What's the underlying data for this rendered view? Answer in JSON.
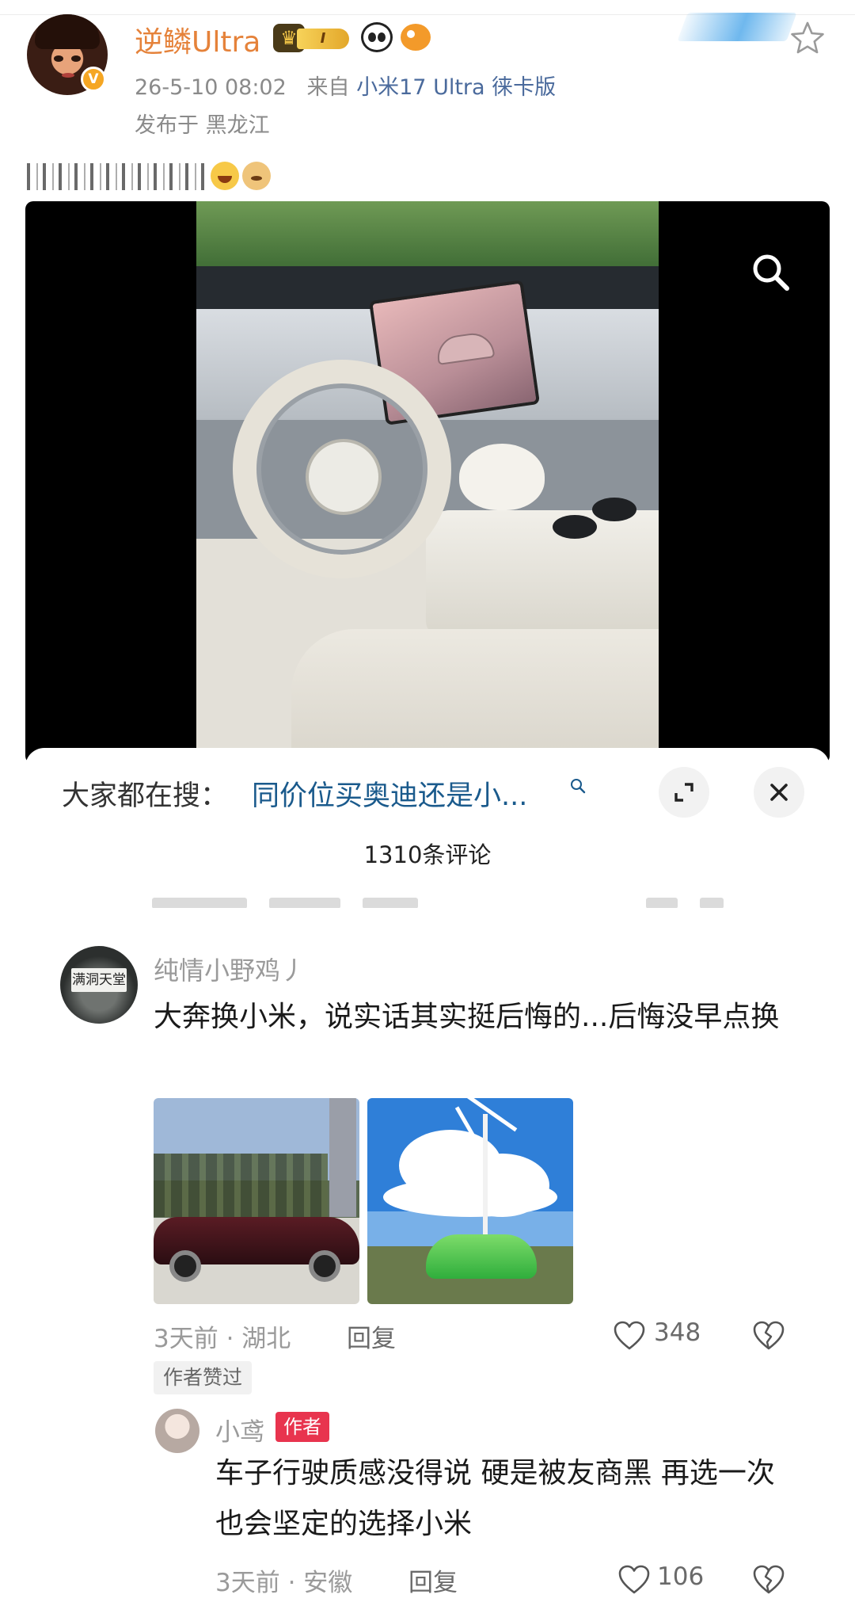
{
  "post": {
    "username": "逆鳞Ultra",
    "rank_badge": "I",
    "datetime": "26-5-10 08:02",
    "source_prefix": "来自",
    "source": "小米17 Ultra 徕卡版",
    "location": "发布于 黑龙江"
  },
  "sheet": {
    "search_label": "大家都在搜：",
    "search_suggestion": "同价位买奥迪还是小...",
    "comment_count": "1310条评论"
  },
  "comments": [
    {
      "name": "纯情小野鸡丿",
      "avatar_sign": "满洞天堂",
      "text": "大奔换小米，说实话其实挺后悔的...后悔没早点换",
      "time_loc": "3天前 · 湖北",
      "reply_label": "回复",
      "likes": "348",
      "author_liked": "作者赞过",
      "reply": {
        "name": "小鸢",
        "tag": "作者",
        "text": "车子行驶质感没得说 硬是被友商黑 再选一次也会坚定的选择小米",
        "time_loc": "3天前 · 安徽",
        "reply_label": "回复",
        "likes": "106"
      }
    }
  ],
  "icons": {
    "star": "star-icon",
    "search": "search-icon",
    "expand": "expand-icon",
    "close": "close-icon",
    "like": "heart-icon",
    "dislike": "broken-heart-icon"
  },
  "colors": {
    "username": "#e5823a",
    "link": "#1a5a8c",
    "author_tag": "#e8344e",
    "verified": "#f5a623"
  }
}
